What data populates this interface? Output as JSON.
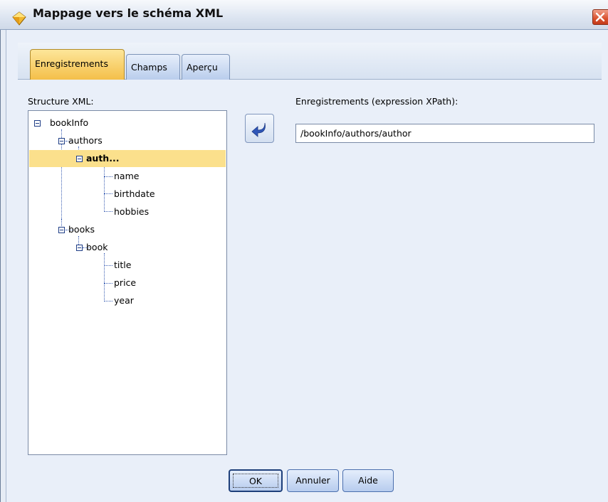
{
  "window": {
    "title": "Mappage vers le schéma XML",
    "icon": "diamond-icon",
    "close_icon": "close-icon"
  },
  "tabs": [
    {
      "label": "Enregistrements",
      "active": true
    },
    {
      "label": "Champs",
      "active": false
    },
    {
      "label": "Aperçu",
      "active": false
    }
  ],
  "structure": {
    "label": "Structure XML:",
    "tree": [
      {
        "label": "bookInfo",
        "level": 0,
        "expanded": true
      },
      {
        "label": "authors",
        "level": 1,
        "expanded": true
      },
      {
        "label": "auth...",
        "level": 2,
        "expanded": true,
        "selected": true
      },
      {
        "label": "name",
        "level": 3
      },
      {
        "label": "birthdate",
        "level": 3
      },
      {
        "label": "hobbies",
        "level": 3
      },
      {
        "label": "books",
        "level": 1,
        "expanded": true
      },
      {
        "label": "book",
        "level": 2,
        "expanded": true
      },
      {
        "label": "title",
        "level": 3
      },
      {
        "label": "price",
        "level": 3
      },
      {
        "label": "year",
        "level": 3
      }
    ]
  },
  "records": {
    "label": "Enregistrements (expression XPath):",
    "value": "/bookInfo/authors/author",
    "insert_icon": "arrow-left-icon"
  },
  "buttons": {
    "ok": "OK",
    "cancel": "Annuler",
    "help": "Aide"
  },
  "colors": {
    "selection": "#fbe08c",
    "active_tab": "#f4bf49",
    "accent": "#2f56b8"
  }
}
